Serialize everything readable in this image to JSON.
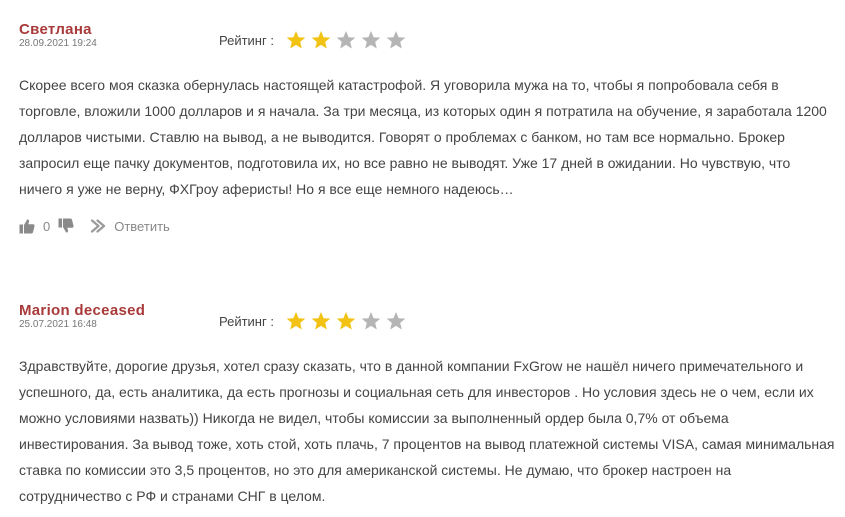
{
  "reviews": [
    {
      "author": "Светлана",
      "date": "28.09.2021 19:24",
      "rating_label": "Рейтинг :",
      "rating": 2,
      "rating_max": 5,
      "text": "Скорее всего моя сказка обернулась настоящей катастрофой. Я уговорила мужа на то, чтобы я попробовала себя в торговле, вложили 1000 долларов и я начала. За три месяца, из которых один я потратила на обучение, я заработала 1200 долларов чистыми. Ставлю на вывод, а не выводится. Говорят о проблемах с банком, но там все нормально. Брокер запросил еще пачку документов, подготовила их, но все равно не выводят. Уже 17 дней в ожидании. Но чувствую, что ничего я уже не верну, ФХГроу аферисты! Но я все еще немного надеюсь…",
      "likes": "0",
      "reply_label": "Ответить"
    },
    {
      "author": "Marion deceased",
      "date": "25.07.2021 16:48",
      "rating_label": "Рейтинг :",
      "rating": 3,
      "rating_max": 5,
      "text": "Здравствуйте, дорогие друзья, хотел сразу сказать, что в данной компании FxGrow не нашёл ничего примечательного и успешного, да, есть аналитика, да есть прогнозы и социальная сеть для инвесторов . Но условия здесь не о чем, если их можно условиями назвать)) Никогда не видел, чтобы комиссии за выполненный ордер была 0,7% от объема инвестирования. За вывод тоже, хоть стой, хоть плачь, 7 процентов на вывод платежной системы VISA, самая минимальная ставка по комиссии это 3,5 процентов, но это для американской системы. Не думаю, что брокер настроен на сотрудничество с РФ и странами СНГ в целом."
    }
  ],
  "colors": {
    "author": "#a93a3a",
    "star_filled": "#f2c314",
    "star_empty": "#b5b5b5",
    "text": "#444444",
    "muted": "#888888"
  },
  "icons": {
    "star": "star-icon",
    "like": "thumbs-up-icon",
    "dislike": "thumbs-down-icon",
    "reply": "reply-arrow-icon"
  }
}
